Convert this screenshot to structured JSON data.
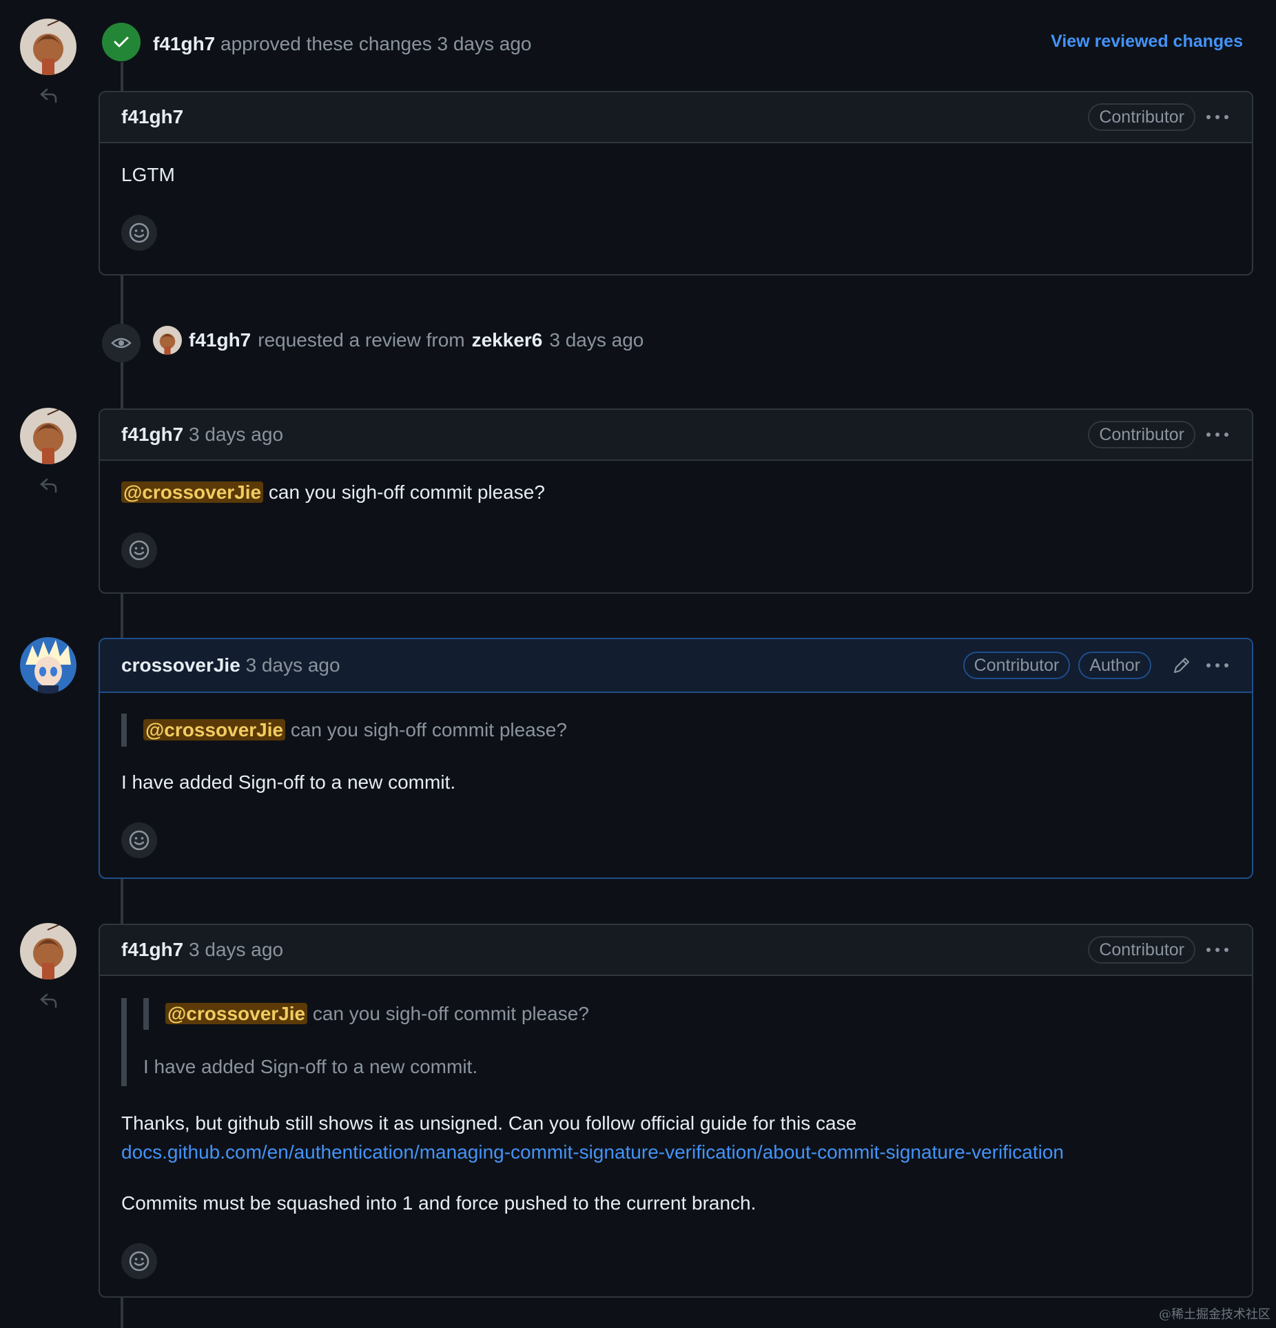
{
  "review": {
    "user": "f41gh7",
    "action": "approved these changes",
    "time": "3 days ago",
    "view_link": "View reviewed changes"
  },
  "review_comment": {
    "user": "f41gh7",
    "badge": "Contributor",
    "body": "LGTM"
  },
  "review_request": {
    "user": "f41gh7",
    "action": "requested a review from",
    "target": "zekker6",
    "time": "3 days ago"
  },
  "comments": [
    {
      "user": "f41gh7",
      "time": "3 days ago",
      "badges": [
        "Contributor"
      ],
      "mention": "@crossoverJie",
      "text": " can you sigh-off commit please?"
    },
    {
      "user": "crossoverJie",
      "time": "3 days ago",
      "badges": [
        "Contributor",
        "Author"
      ],
      "quote_mention": "@crossoverJie",
      "quote_text": " can you sigh-off commit please?",
      "text": "I have added Sign-off to a new commit."
    },
    {
      "user": "f41gh7",
      "time": "3 days ago",
      "badges": [
        "Contributor"
      ],
      "quote_mention": "@crossoverJie",
      "quote_text": " can you sigh-off commit please?",
      "quote_reply": "I have added Sign-off to a new commit.",
      "text1": "Thanks, but github still shows it as unsigned. Can you follow official guide for this case",
      "link": "docs.github.com/en/authentication/managing-commit-signature-verification/about-commit-signature-verification",
      "text2": "Commits must be squashed into 1 and force pushed to the current branch."
    }
  ],
  "watermark": "@稀土掘金技术社区",
  "icons": {
    "check": "check-icon",
    "eye": "eye-icon",
    "reply": "reply-icon",
    "kebab": "kebab-horizontal-icon",
    "smiley": "smiley-icon",
    "pencil": "pencil-icon"
  },
  "colors": {
    "background": "#0d1117",
    "header": "#161b22",
    "border": "#30363d",
    "accent_link": "#4493f8",
    "approved": "#238636",
    "mention_bg": "#5b3a08",
    "mention_fg": "#f2cc60"
  }
}
